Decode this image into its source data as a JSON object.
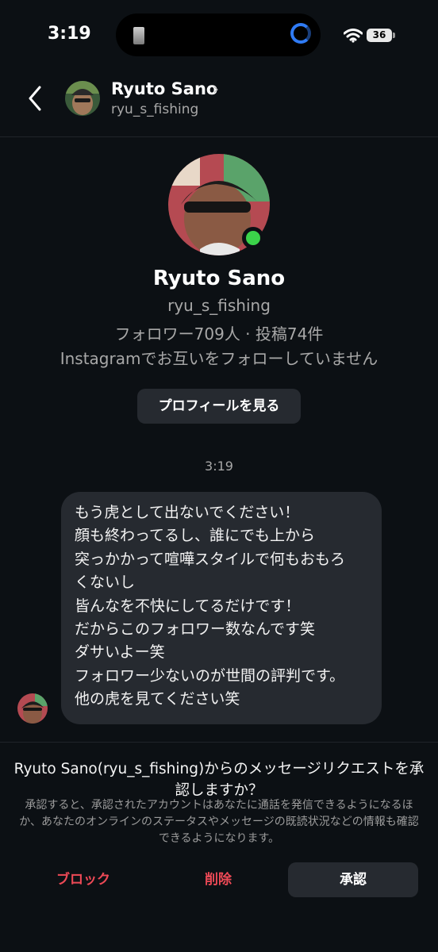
{
  "status_bar": {
    "time": "3:19",
    "battery": "36"
  },
  "header": {
    "name": "Ryuto Sano",
    "chevron": "›",
    "username": "ryu_s_fishing"
  },
  "profile": {
    "name": "Ryuto Sano",
    "username": "ryu_s_fishing",
    "stats": "フォロワー709人 · 投稿74件",
    "mutual": "Instagramでお互いをフォローしていません",
    "view_profile_label": "プロフィールを見る"
  },
  "timestamp": "3:19",
  "message": {
    "lines": [
      "もう虎として出ないでください！",
      "顔も終わってるし、誰にでも上から",
      "突っかかって喧嘩スタイルで何もおもろ",
      "くないし",
      "皆んなを不快にしてるだけです！",
      "だからこのフォロワー数なんです笑",
      "ダサいよー笑",
      "フォロワー少ないのが世間の評判です。",
      "他の虎を見てください笑"
    ]
  },
  "request": {
    "title": "Ryuto Sano(ryu_s_fishing)からのメッセージリクエストを承認しますか？",
    "body": "承認すると、承認されたアカウントはあなたに通話を発信できるようになるほか、あなたのオンラインのステータスやメッセージの既読状況などの情報も確認できるようになります。",
    "block_label": "ブロック",
    "delete_label": "削除",
    "accept_label": "承認"
  },
  "colors": {
    "background": "#0c1014",
    "online": "#3bd34a",
    "danger": "#ed4956",
    "button_bg": "#262a30"
  },
  "icons": [
    "back-chevron-icon",
    "wifi-icon",
    "battery-icon",
    "online-status-icon"
  ]
}
